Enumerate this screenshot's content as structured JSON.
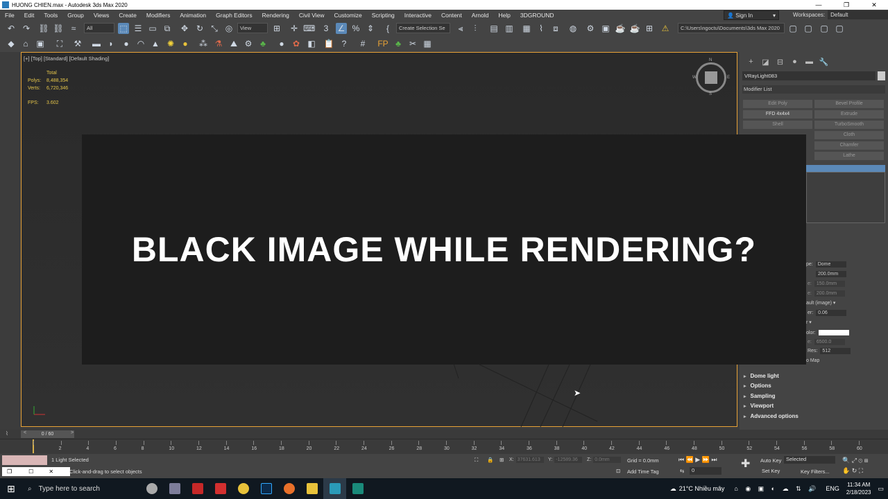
{
  "window": {
    "title": "HUONG CHIEN.max - Autodesk 3ds Max 2020",
    "controls": [
      "—",
      "❐",
      "✕"
    ]
  },
  "menu": [
    "File",
    "Edit",
    "Tools",
    "Group",
    "Views",
    "Create",
    "Modifiers",
    "Animation",
    "Graph Editors",
    "Rendering",
    "Civil View",
    "Customize",
    "Scripting",
    "Interactive",
    "Content",
    "Arnold",
    "Help",
    "3DGROUND"
  ],
  "signin": "Sign In",
  "workspaces": {
    "label": "Workspaces:",
    "value": "Default"
  },
  "toolbar": {
    "filter": "All",
    "view": "View",
    "selection_set": "Create Selection Se",
    "path": "C:\\Users\\ngoctu\\Documents\\3ds Max 2020"
  },
  "viewport": {
    "label": "[+] [Top] [Standard] [Default Shading]",
    "stats": {
      "total_label": "Total",
      "polys_label": "Polys:",
      "polys": "8,488,354",
      "verts_label": "Verts:",
      "verts": "6,720,346",
      "fps_label": "FPS:",
      "fps": "3.602"
    },
    "viewcube": {
      "n": "N",
      "s": "S",
      "w": "W",
      "e": "E"
    }
  },
  "overlay": {
    "headline": "BLACK IMAGE WHILE RENDERING?"
  },
  "command_panel": {
    "object_name": "VRayLight083",
    "modifier_list": "Modifier List",
    "modifiers": [
      "Edit Poly",
      "Bevel Profile",
      "FFD 4x4x4",
      "Extrude",
      "Shell",
      "TurboSmooth",
      "Cloth",
      "Chamfer",
      "Lathe"
    ],
    "params": [
      {
        "label": "pe:",
        "value": "Dome"
      },
      {
        "label": "",
        "value": "200.0mm"
      },
      {
        "label": "e:",
        "value": "150.0mm"
      },
      {
        "label": "e:",
        "value": "200.0mm"
      },
      {
        "label": "ault (image)",
        "value": ""
      },
      {
        "label": "er:",
        "value": "0.06"
      },
      {
        "label": "r",
        "value": ""
      },
      {
        "label": "olor:",
        "value": ""
      },
      {
        "label": "e:",
        "value": "6500.0"
      },
      {
        "label": "Res:",
        "value": "512"
      },
      {
        "label": "o Map",
        "value": ""
      }
    ],
    "rollouts": [
      "Dome light",
      "Options",
      "Sampling",
      "Viewport",
      "Advanced options"
    ]
  },
  "timeline": {
    "slider": "0 / 60",
    "ticks": [
      "0",
      "2",
      "4",
      "6",
      "8",
      "10",
      "12",
      "14",
      "16",
      "18",
      "20",
      "22",
      "24",
      "26",
      "28",
      "30",
      "32",
      "34",
      "36",
      "38",
      "40",
      "42",
      "44",
      "46",
      "48",
      "50",
      "52",
      "54",
      "56",
      "58",
      "60"
    ]
  },
  "status": {
    "selected": "1 Light Selected",
    "prompt": "Click-and-drag to select objects",
    "x_label": "X:",
    "x": "37631.613",
    "y_label": "Y:",
    "y": "-12589.36",
    "z_label": "Z:",
    "z": "0.0mm",
    "grid": "Grid = 0.0mm",
    "add_time_tag": "Add Time Tag",
    "auto_key": "Auto Key",
    "set_key": "Set Key",
    "key_mode": "Selected",
    "key_filters": "Key Filters...",
    "frame": "0"
  },
  "taskbar": {
    "search": "Type here to search",
    "weather": "21°C  Nhiều mây",
    "lang": "ENG",
    "time": "11:34 AM",
    "date": "2/18/2023"
  },
  "colors": {
    "accent": "#5b89b8",
    "viewport_border": "#e8a236",
    "overlay": "#1d1d1d"
  }
}
